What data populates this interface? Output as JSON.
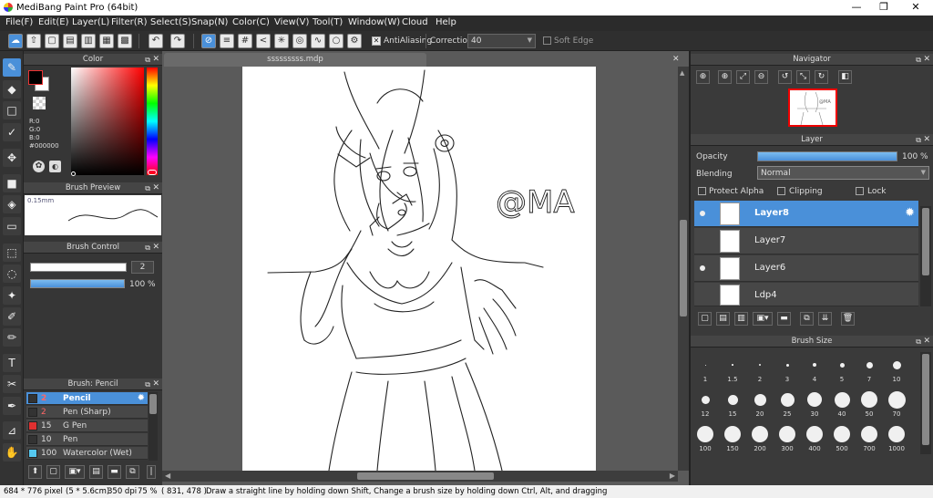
{
  "window": {
    "title": "MediBang Paint Pro (64bit)",
    "minimize": "—",
    "restore": "❐",
    "close": "✕"
  },
  "menu": [
    "File(F)",
    "Edit(E)",
    "Layer(L)",
    "Filter(R)",
    "Select(S)",
    "Snap(N)",
    "Color(C)",
    "View(V)",
    "Tool(T)",
    "Window(W)",
    "Cloud",
    "Help"
  ],
  "toolbar": {
    "antialiasing_label": "AntiAliasing",
    "correction_label": "Correction",
    "correction_value": "40",
    "soft_edge_label": "Soft Edge"
  },
  "color_panel": {
    "title": "Color",
    "r": "R:0",
    "g": "G:0",
    "b": "B:0",
    "hex": "#000000"
  },
  "brush_preview": {
    "title": "Brush Preview",
    "size": "0.15mm"
  },
  "brush_control": {
    "title": "Brush Control",
    "size_value": "2",
    "opacity_value": "100 %"
  },
  "brush_list": {
    "title": "Brush: Pencil",
    "items": [
      {
        "size": "2",
        "name": "Pencil",
        "color": "#333333",
        "selected": true
      },
      {
        "size": "2",
        "name": "Pen (Sharp)",
        "color": "#333333"
      },
      {
        "size": "15",
        "name": "G Pen",
        "color": "#e03030"
      },
      {
        "size": "10",
        "name": "Pen",
        "color": "#333333"
      },
      {
        "size": "100",
        "name": "Watercolor (Wet)",
        "color": "#55c8f0"
      }
    ]
  },
  "document": {
    "tab": "sssssssss.mdp",
    "watermark": "@MA"
  },
  "navigator": {
    "title": "Navigator"
  },
  "layer_panel": {
    "title": "Layer",
    "opacity_label": "Opacity",
    "opacity_value": "100 %",
    "opacity_fraction": 1.0,
    "blending_label": "Blending",
    "blending_value": "Normal",
    "protect_alpha": "Protect Alpha",
    "clipping": "Clipping",
    "lock": "Lock",
    "layers": [
      {
        "name": "Layer8",
        "selected": true,
        "visible": true
      },
      {
        "name": "Layer7",
        "visible": false
      },
      {
        "name": "Layer6",
        "visible": true
      },
      {
        "name": "Ldp4",
        "visible": false
      }
    ]
  },
  "brush_size": {
    "title": "Brush Size",
    "sizes": [
      "1",
      "1.5",
      "2",
      "3",
      "4",
      "5",
      "7",
      "10",
      "12",
      "15",
      "20",
      "25",
      "30",
      "40",
      "50",
      "70",
      "100",
      "150",
      "200",
      "300",
      "400",
      "500",
      "700",
      "1000"
    ]
  },
  "status": {
    "pixels": "684 * 776 pixel",
    "physical": "(5 * 5.6cm)",
    "dpi": "350 dpi",
    "zoom": "75 %",
    "coords": "( 831, 478 )",
    "hint": "Draw a straight line by holding down Shift, Change a brush size by holding down Ctrl, Alt, and dragging"
  },
  "colors": {
    "accent": "#4a90d9",
    "panel": "#363636",
    "header": "#454545"
  }
}
